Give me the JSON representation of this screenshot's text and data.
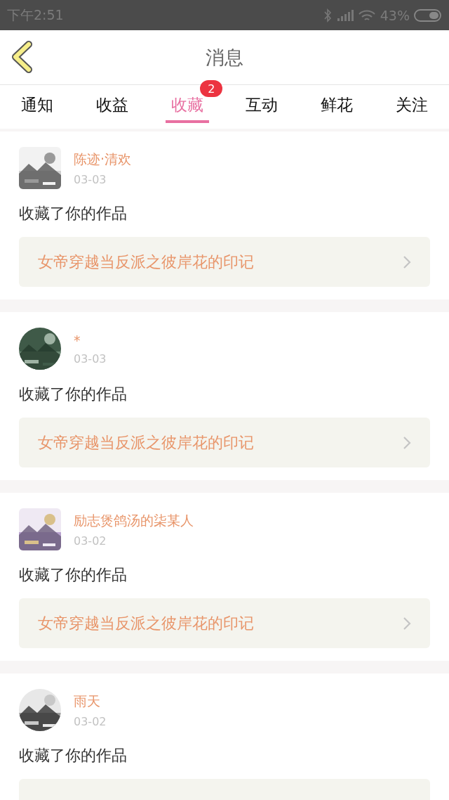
{
  "status_bar": {
    "time": "下午2:51",
    "battery": "43%"
  },
  "header": {
    "title": "消息"
  },
  "tabs": [
    {
      "label": "通知",
      "selected": false
    },
    {
      "label": "收益",
      "selected": false
    },
    {
      "label": "收藏",
      "selected": true,
      "badge": "2"
    },
    {
      "label": "互动",
      "selected": false
    },
    {
      "label": "鲜花",
      "selected": false
    },
    {
      "label": "关注",
      "selected": false
    }
  ],
  "messages": [
    {
      "user": "陈迹·清欢",
      "date": "03-03",
      "action": "收藏了你的作品",
      "work": "女帝穿越当反派之彼岸花的印记"
    },
    {
      "user": "*",
      "date": "03-03",
      "action": "收藏了你的作品",
      "work": "女帝穿越当反派之彼岸花的印记"
    },
    {
      "user": "励志煲鸽汤的柒某人",
      "date": "03-02",
      "action": "收藏了你的作品",
      "work": "女帝穿越当反派之彼岸花的印记"
    },
    {
      "user": "雨天",
      "date": "03-02",
      "action": "收藏了你的作品"
    }
  ]
}
